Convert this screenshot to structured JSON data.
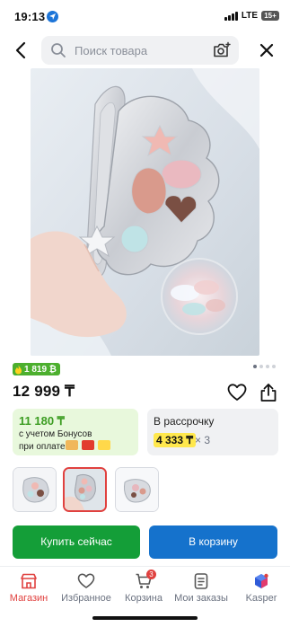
{
  "status_bar": {
    "time": "19:13",
    "network": "LTE",
    "battery": "15+"
  },
  "search": {
    "placeholder": "Поиск товара"
  },
  "gallery": {
    "total": 4,
    "current": 1
  },
  "product": {
    "bonus_count": "1 819 ₿",
    "price": "12 999 ₸"
  },
  "bonus_card": {
    "amount": "11 180 ₸",
    "line1": "с учетом Бонусов",
    "line2": "при оплате"
  },
  "installment_card": {
    "title": "В рассрочку",
    "amount": "4 333 ₸",
    "times": "× 3"
  },
  "actions": {
    "buy_now": "Купить сейчас",
    "add_to_cart": "В корзину"
  },
  "nav": {
    "items": [
      {
        "label": "Магазин",
        "icon": "shop-icon",
        "active": true
      },
      {
        "label": "Избранное",
        "icon": "heart-icon"
      },
      {
        "label": "Корзина",
        "icon": "cart-icon",
        "badge": "3"
      },
      {
        "label": "Мои заказы",
        "icon": "orders-icon"
      },
      {
        "label": "Kasper",
        "icon": "kasper-icon"
      }
    ]
  },
  "colors": {
    "accent_red": "#e0413f",
    "buy_green": "#149e38",
    "cart_blue": "#1572cc",
    "bonus_green": "#3c9d22",
    "installment_yellow": "#ffe84d"
  }
}
